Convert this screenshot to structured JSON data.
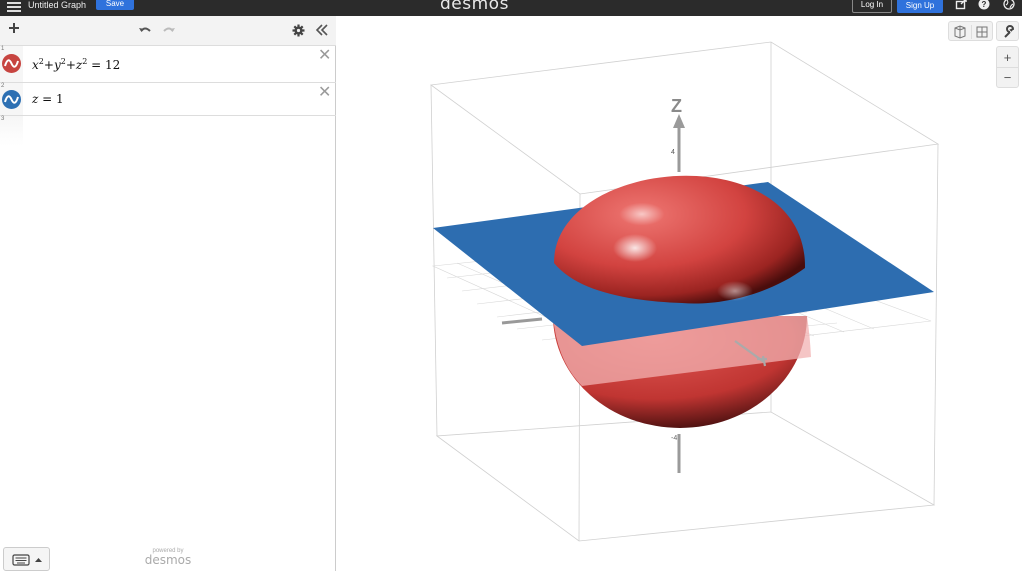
{
  "topbar": {
    "title": "Untitled Graph",
    "save_label": "Save",
    "logo": "desmos",
    "login_label": "Log In",
    "signup_label": "Sign Up"
  },
  "expressions": [
    {
      "index": "1",
      "color": "#c74440",
      "base": "x",
      "sup": "2",
      "y": "y",
      "z": "z",
      "rhs": "12"
    },
    {
      "index": "2",
      "color": "#2d70b3",
      "lhs": "z",
      "eq": "=",
      "rhs": "1"
    },
    {
      "index": "3"
    }
  ],
  "footer": {
    "powered_by": "powered by",
    "brand": "desmos"
  },
  "graph": {
    "axis_label_z": "Z",
    "tick_top": "4",
    "tick_bottom": "-4",
    "zoom_in": "+",
    "zoom_out": "−"
  },
  "colors": {
    "sphere": "#d94643",
    "plane": "#2d70b3",
    "save_button": "#2f72dc",
    "topbar": "#2b2b2b"
  },
  "icons": [
    "menu-icon",
    "add-icon",
    "undo-icon",
    "redo-icon",
    "gear-icon",
    "collapse-icon",
    "close-icon",
    "keyboard-icon",
    "share-icon",
    "help-icon",
    "globe-icon",
    "wrench-icon",
    "cube-view-icon",
    "grid-view-icon"
  ]
}
